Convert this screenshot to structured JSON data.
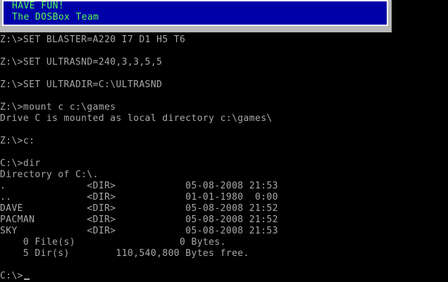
{
  "banner": {
    "lines": [
      "HAVE FUN!",
      "The DOSBox Team"
    ]
  },
  "console": {
    "lines": [
      "Z:\\>SET BLASTER=A220 I7 D1 H5 T6",
      "",
      "Z:\\>SET ULTRASND=240,3,3,5,5",
      "",
      "Z:\\>SET ULTRADIR=C:\\ULTRASND",
      "",
      "Z:\\>mount c c:\\games",
      "Drive C is mounted as local directory c:\\games\\",
      "",
      "Z:\\>c:",
      "",
      "C:\\>dir",
      "Directory of C:\\.",
      ".              <DIR>            05-08-2008 21:53",
      "..             <DIR>            01-01-1980  0:00",
      "DAVE           <DIR>            05-08-2008 21:52",
      "PACMAN         <DIR>            05-08-2008 21:52",
      "SKY            <DIR>            05-08-2008 21:53",
      "    0 File(s)                  0 Bytes.",
      "    5 Dir(s)        110,540,800 Bytes free.",
      ""
    ],
    "prompt": "C:\\>"
  },
  "colors": {
    "background": "#000000",
    "text": "#a8a8a8",
    "banner_bg": "#0000a8",
    "banner_text": "#55ff55",
    "banner_border": "#ffffff"
  }
}
